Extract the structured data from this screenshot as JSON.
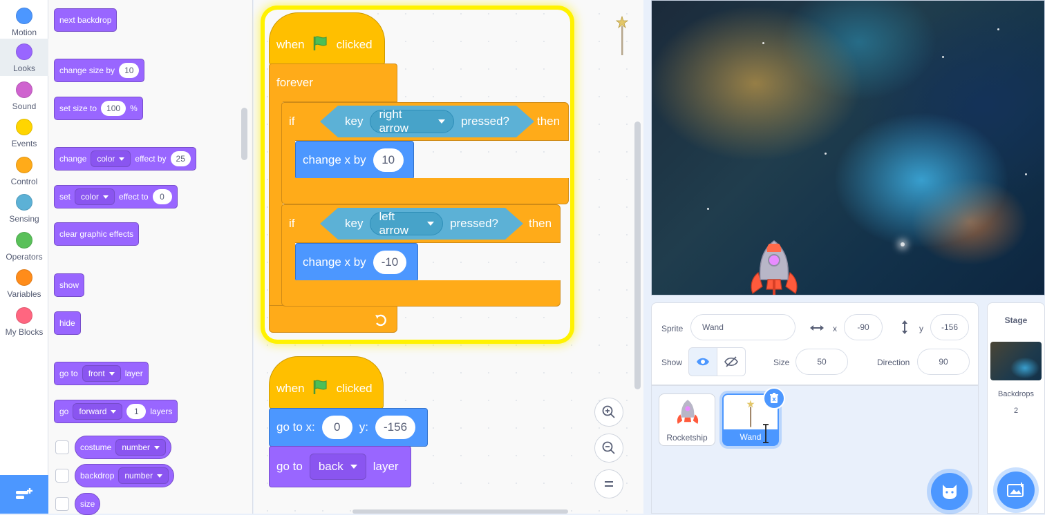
{
  "categories": [
    {
      "label": "Motion",
      "color": "#4c97ff"
    },
    {
      "label": "Looks",
      "color": "#9966ff"
    },
    {
      "label": "Sound",
      "color": "#cf63cf"
    },
    {
      "label": "Events",
      "color": "#ffd500"
    },
    {
      "label": "Control",
      "color": "#ffab19"
    },
    {
      "label": "Sensing",
      "color": "#5cb1d6"
    },
    {
      "label": "Operators",
      "color": "#59c059"
    },
    {
      "label": "Variables",
      "color": "#ff8c1a"
    },
    {
      "label": "My Blocks",
      "color": "#ff6680"
    }
  ],
  "active_category": "Looks",
  "palette": {
    "next_backdrop": "next backdrop",
    "change_size": {
      "label": "change size by",
      "value": "10"
    },
    "set_size": {
      "label": "set size to",
      "value": "100",
      "unit": "%"
    },
    "change_effect": {
      "label": "change",
      "effect": "color",
      "label2": "effect by",
      "value": "25"
    },
    "set_effect": {
      "label": "set",
      "effect": "color",
      "label2": "effect to",
      "value": "0"
    },
    "clear_effects": "clear graphic effects",
    "show": "show",
    "hide": "hide",
    "go_to_layer": {
      "label": "go to",
      "option": "front",
      "label2": "layer"
    },
    "go_layers": {
      "label": "go",
      "option": "forward",
      "value": "1",
      "label2": "layers"
    },
    "costume": {
      "label": "costume",
      "option": "number"
    },
    "backdrop": {
      "label": "backdrop",
      "option": "number"
    },
    "size": "size"
  },
  "script1": {
    "when": "when",
    "clicked": "clicked",
    "forever": "forever",
    "if1": {
      "if": "if",
      "key": "key",
      "option": "right arrow",
      "pressed": "pressed?",
      "then": "then",
      "move_label": "change x by",
      "move_value": "10"
    },
    "if2": {
      "if": "if",
      "key": "key",
      "option": "left arrow",
      "pressed": "pressed?",
      "then": "then",
      "move_label": "change x by",
      "move_value": "-10"
    }
  },
  "script2": {
    "when": "when",
    "clicked": "clicked",
    "goto_x_label": "go to x:",
    "x": "0",
    "y_label": "y:",
    "y": "-156",
    "layer": {
      "label": "go to",
      "option": "back",
      "label2": "layer"
    }
  },
  "sprite_info": {
    "sprite_label": "Sprite",
    "sprite_name": "Wand",
    "x_label": "x",
    "x": "-90",
    "y_label": "y",
    "y": "-156",
    "show_label": "Show",
    "size_label": "Size",
    "size": "50",
    "direction_label": "Direction",
    "direction": "90"
  },
  "sprites": [
    {
      "name": "Rocketship",
      "selected": false
    },
    {
      "name": "Wand",
      "selected": true
    }
  ],
  "stage_pane": {
    "title": "Stage",
    "backdrops_label": "Backdrops",
    "backdrops_count": "2"
  }
}
